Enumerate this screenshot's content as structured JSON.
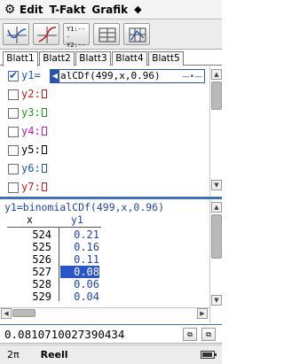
{
  "menu": {
    "items": [
      "Edit",
      "T-Fakt",
      "Grafik"
    ],
    "more_glyph": "◆",
    "settings_icon": "gear-icon"
  },
  "toolbar": {
    "buttons": [
      {
        "name": "graph-view-icon"
      },
      {
        "name": "graph-view-split-icon"
      },
      {
        "name": "function-list-y1-icon",
        "text": "Y1:--\nY2:--"
      },
      {
        "name": "table-view-icon"
      },
      {
        "name": "table-view-alt-icon"
      }
    ],
    "y1_line1": "Y1:---",
    "y1_line2": "Y2:---"
  },
  "tabs": [
    "Blatt1",
    "Blatt2",
    "Blatt3",
    "Blatt4",
    "Blatt5"
  ],
  "active_tab": "Blatt1",
  "functions": [
    {
      "label": "y1=",
      "expr": "alCDf(499,x,0.96)",
      "checked": true,
      "color": "#1b57b6"
    },
    {
      "label": "y2:",
      "checked": false,
      "color": "#d01818"
    },
    {
      "label": "y3:",
      "checked": false,
      "color": "#1a9a1a"
    },
    {
      "label": "y4:",
      "checked": false,
      "color": "#c418c4"
    },
    {
      "label": "y5:",
      "checked": false,
      "color": "#000000"
    },
    {
      "label": "y6:",
      "checked": false,
      "color": "#1b57b6"
    },
    {
      "label": "y7:",
      "checked": false,
      "color": "#d01818"
    }
  ],
  "table": {
    "function_text": "y1=binomialCDf(499,x,0.96)",
    "col_x": "x",
    "col_y": "y1",
    "rows": [
      {
        "x": "524",
        "y": "0.21"
      },
      {
        "x": "525",
        "y": "0.16"
      },
      {
        "x": "526",
        "y": "0.11"
      },
      {
        "x": "527",
        "y": "0.08"
      },
      {
        "x": "528",
        "y": "0.06"
      },
      {
        "x": "529",
        "y": "0.04"
      }
    ],
    "highlight_row": 3
  },
  "entry": {
    "value": "0.0810710027390434"
  },
  "status": {
    "angle": "2π",
    "mode": "Reell"
  }
}
